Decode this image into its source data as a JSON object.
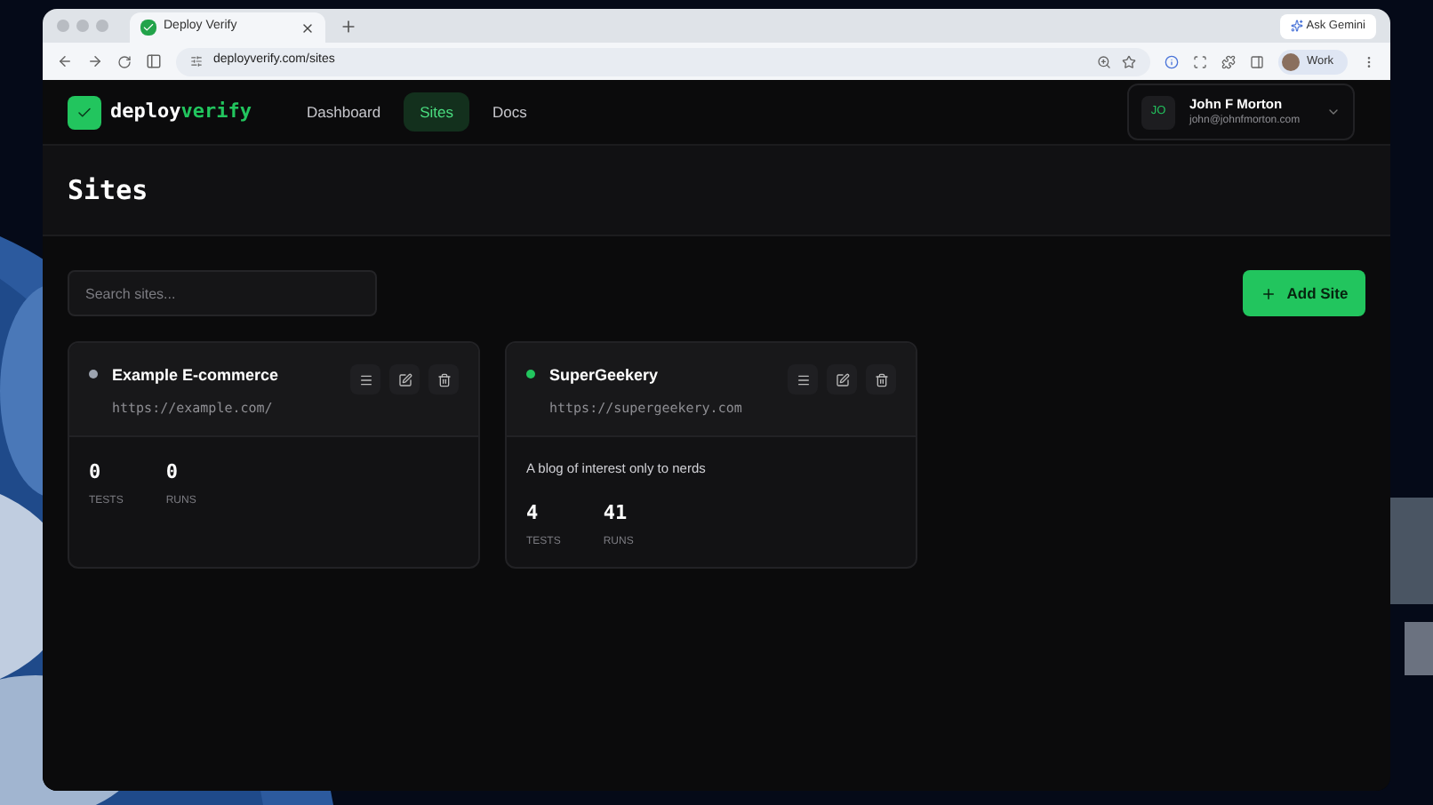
{
  "browser": {
    "tab_title": "Deploy Verify",
    "ask_button": "Ask Gemini",
    "url": "deployverify.com/sites",
    "profile": "Work"
  },
  "app": {
    "logo_part_1": "deploy",
    "logo_part_2": "verify",
    "nav": [
      {
        "label": "Dashboard",
        "selected": false
      },
      {
        "label": "Sites",
        "selected": true
      },
      {
        "label": "Docs",
        "selected": false
      }
    ],
    "user": {
      "initials": "JO",
      "name": "John F Morton",
      "email": "john@johnfmorton.com"
    }
  },
  "page_title": "Sites",
  "search": {
    "placeholder": "Search sites..."
  },
  "add_button": "Add Site",
  "sites": [
    {
      "name": "Example E-commerce",
      "url": "https://example.com/",
      "color": "#9ca3af",
      "stats": [
        {
          "value": "0",
          "label": "TESTS"
        },
        {
          "value": "0",
          "label": "RUNS"
        }
      ]
    },
    {
      "name": "SuperGeekery",
      "url": "https://supergeekery.com",
      "color": "#22c55e",
      "description": "A blog of interest only to nerds",
      "stats": [
        {
          "value": "4",
          "label": "TESTS"
        },
        {
          "value": "41",
          "label": "RUNS"
        }
      ]
    }
  ]
}
